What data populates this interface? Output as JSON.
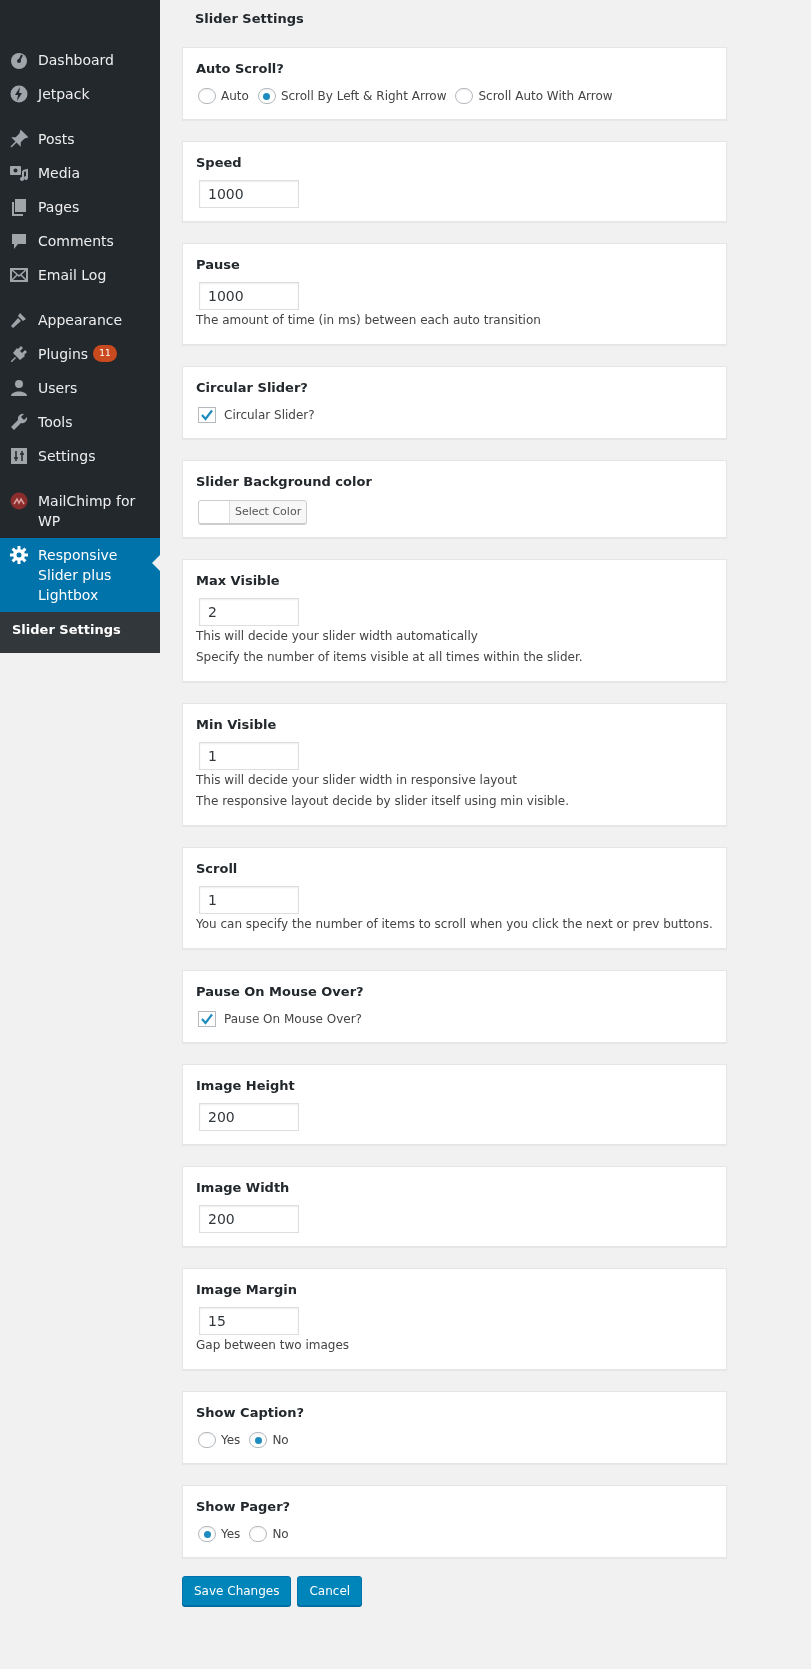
{
  "sidebar": {
    "groups": [
      [
        {
          "label": "Dashboard"
        },
        {
          "label": "Jetpack"
        }
      ],
      [
        {
          "label": "Posts"
        },
        {
          "label": "Media"
        },
        {
          "label": "Pages"
        },
        {
          "label": "Comments"
        },
        {
          "label": "Email Log"
        }
      ],
      [
        {
          "label": "Appearance"
        },
        {
          "label": "Plugins",
          "badge": "11"
        },
        {
          "label": "Users"
        },
        {
          "label": "Tools"
        },
        {
          "label": "Settings"
        }
      ],
      [
        {
          "label": "MailChimp for WP",
          "selected": false
        },
        {
          "label": "Responsive Slider plus Lightbox",
          "selected": true
        }
      ]
    ],
    "submenu": [
      {
        "label": "Slider Settings",
        "selected": true
      }
    ]
  },
  "page_title": "Slider Settings",
  "fields": [
    {
      "kind": "radio",
      "label": "Auto Scroll?",
      "options": [
        {
          "label": "Auto",
          "selected": false
        },
        {
          "label": "Scroll By Left & Right Arrow",
          "selected": true
        },
        {
          "label": "Scroll Auto With Arrow",
          "selected": false
        }
      ]
    },
    {
      "kind": "text",
      "label": "Speed",
      "value": "1000"
    },
    {
      "kind": "text",
      "label": "Pause",
      "value": "1000",
      "descriptions": [
        "The amount of time (in ms) between each auto transition"
      ]
    },
    {
      "kind": "checkbox",
      "label": "Circular Slider?",
      "option": {
        "label": "Circular Slider?",
        "checked": true
      }
    },
    {
      "kind": "color",
      "label": "Slider Background color",
      "button": "Select Color"
    },
    {
      "kind": "text",
      "label": "Max Visible",
      "value": "2",
      "descriptions": [
        "This will decide your slider width automatically",
        "Specify the number of items visible at all times within the slider."
      ]
    },
    {
      "kind": "text",
      "label": "Min Visible",
      "value": "1",
      "descriptions": [
        "This will decide your slider width in responsive layout",
        "The responsive layout decide by slider itself using min visible."
      ]
    },
    {
      "kind": "text",
      "label": "Scroll",
      "value": "1",
      "descriptions": [
        "You can specify the number of items to scroll when you click the next or prev buttons."
      ]
    },
    {
      "kind": "checkbox",
      "label": "Pause On Mouse Over?",
      "option": {
        "label": "Pause On Mouse Over?",
        "checked": true
      }
    },
    {
      "kind": "text",
      "label": "Image Height",
      "value": "200"
    },
    {
      "kind": "text",
      "label": "Image Width",
      "value": "200"
    },
    {
      "kind": "text",
      "label": "Image Margin",
      "value": "15",
      "descriptions": [
        "Gap between two images"
      ]
    },
    {
      "kind": "radio",
      "label": "Show Caption?",
      "options": [
        {
          "label": "Yes",
          "selected": false
        },
        {
          "label": "No",
          "selected": true
        }
      ]
    },
    {
      "kind": "radio",
      "label": "Show Pager?",
      "options": [
        {
          "label": "Yes",
          "selected": true
        },
        {
          "label": "No",
          "selected": false
        }
      ]
    }
  ],
  "buttons": [
    {
      "label": "Save Changes"
    },
    {
      "label": "Cancel"
    }
  ]
}
